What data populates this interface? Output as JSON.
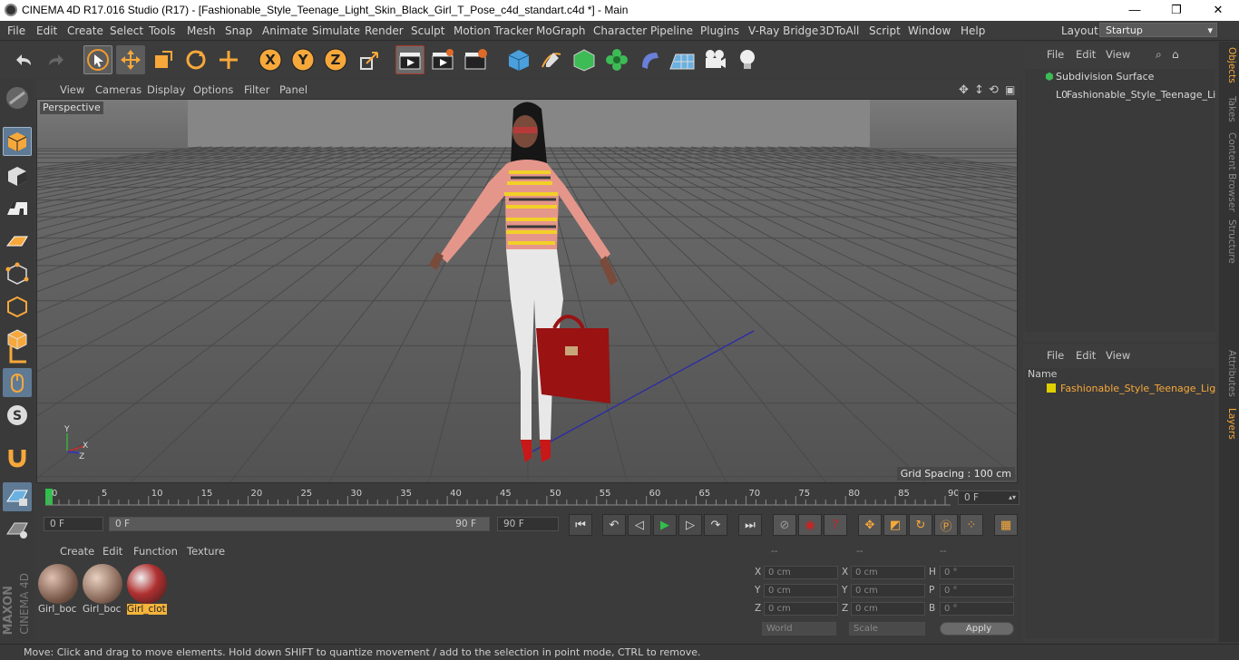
{
  "window": {
    "title": "CINEMA 4D R17.016 Studio (R17) - [Fashionable_Style_Teenage_Light_Skin_Black_Girl_T_Pose_c4d_standart.c4d *] - Main",
    "minimize": "—",
    "maximize": "❐",
    "close": "✕"
  },
  "menu": [
    "File",
    "Edit",
    "Create",
    "Select",
    "Tools",
    "Mesh",
    "Snap",
    "Animate",
    "Simulate",
    "Render",
    "Sculpt",
    "Motion Tracker",
    "MoGraph",
    "Character",
    "Pipeline",
    "Plugins",
    "V-Ray Bridge",
    "3DToAll",
    "Script",
    "Window",
    "Help"
  ],
  "layout": {
    "label": "Layout:",
    "value": "Startup"
  },
  "toolbar": {
    "x_label": "X",
    "y_label": "Y",
    "z_label": "Z"
  },
  "viewport": {
    "menu": [
      "View",
      "Cameras",
      "Display",
      "Options",
      "Filter",
      "Panel"
    ],
    "camera_label": "Perspective",
    "grid_spacing": "Grid Spacing : 100 cm",
    "axis_y": "Y",
    "axis_x": "X",
    "axis_z": "Z"
  },
  "timeline": {
    "ticks": [
      "0",
      "5",
      "10",
      "15",
      "20",
      "25",
      "30",
      "35",
      "40",
      "45",
      "50",
      "55",
      "60",
      "65",
      "70",
      "75",
      "80",
      "85",
      "90"
    ],
    "current_frame": "0 F"
  },
  "playback": {
    "start_frame": "0 F",
    "range_start": "0 F",
    "range_end": "90 F",
    "end_frame": "90 F"
  },
  "material_panel": {
    "menu": [
      "Create",
      "Edit",
      "Function",
      "Texture"
    ],
    "materials": [
      {
        "name": "Girl_boc",
        "selected": false
      },
      {
        "name": "Girl_boc",
        "selected": false
      },
      {
        "name": "Girl_clot",
        "selected": true
      }
    ]
  },
  "coordinates": {
    "headers": [
      "--",
      "--",
      "--"
    ],
    "rows": [
      {
        "axis1": "X",
        "v1": "0 cm",
        "axis2": "X",
        "v2": "0 cm",
        "axis3": "H",
        "v3": "0 °"
      },
      {
        "axis1": "Y",
        "v1": "0 cm",
        "axis2": "Y",
        "v2": "0 cm",
        "axis3": "P",
        "v3": "0 °"
      },
      {
        "axis1": "Z",
        "v1": "0 cm",
        "axis2": "Z",
        "v2": "0 cm",
        "axis3": "B",
        "v3": "0 °"
      }
    ],
    "space": "World",
    "mode": "Scale",
    "apply_label": "Apply"
  },
  "objects_panel": {
    "menu": [
      "File",
      "Edit",
      "View"
    ],
    "items": [
      {
        "name": "Subdivision Surface"
      },
      {
        "name": "Fashionable_Style_Teenage_Ligh"
      }
    ]
  },
  "layers_panel": {
    "menu": [
      "File",
      "Edit",
      "View"
    ],
    "column_header": "Name",
    "items": [
      {
        "name": "Fashionable_Style_Teenage_Light",
        "color": "#e0d000"
      }
    ]
  },
  "side_tabs": [
    "Objects",
    "Takes",
    "Content Browser",
    "Structure",
    "Attributes",
    "Layers"
  ],
  "brand": {
    "maxon": "MAXON",
    "product": "CINEMA 4D"
  },
  "status": "Move: Click and drag to move elements. Hold down SHIFT to quantize movement / add to the selection in point mode, CTRL to remove.",
  "colors": {
    "accent": "#f7a83a",
    "selection": "#f5b43b",
    "play": "#2fbf4a",
    "layer": "#e0d000"
  }
}
